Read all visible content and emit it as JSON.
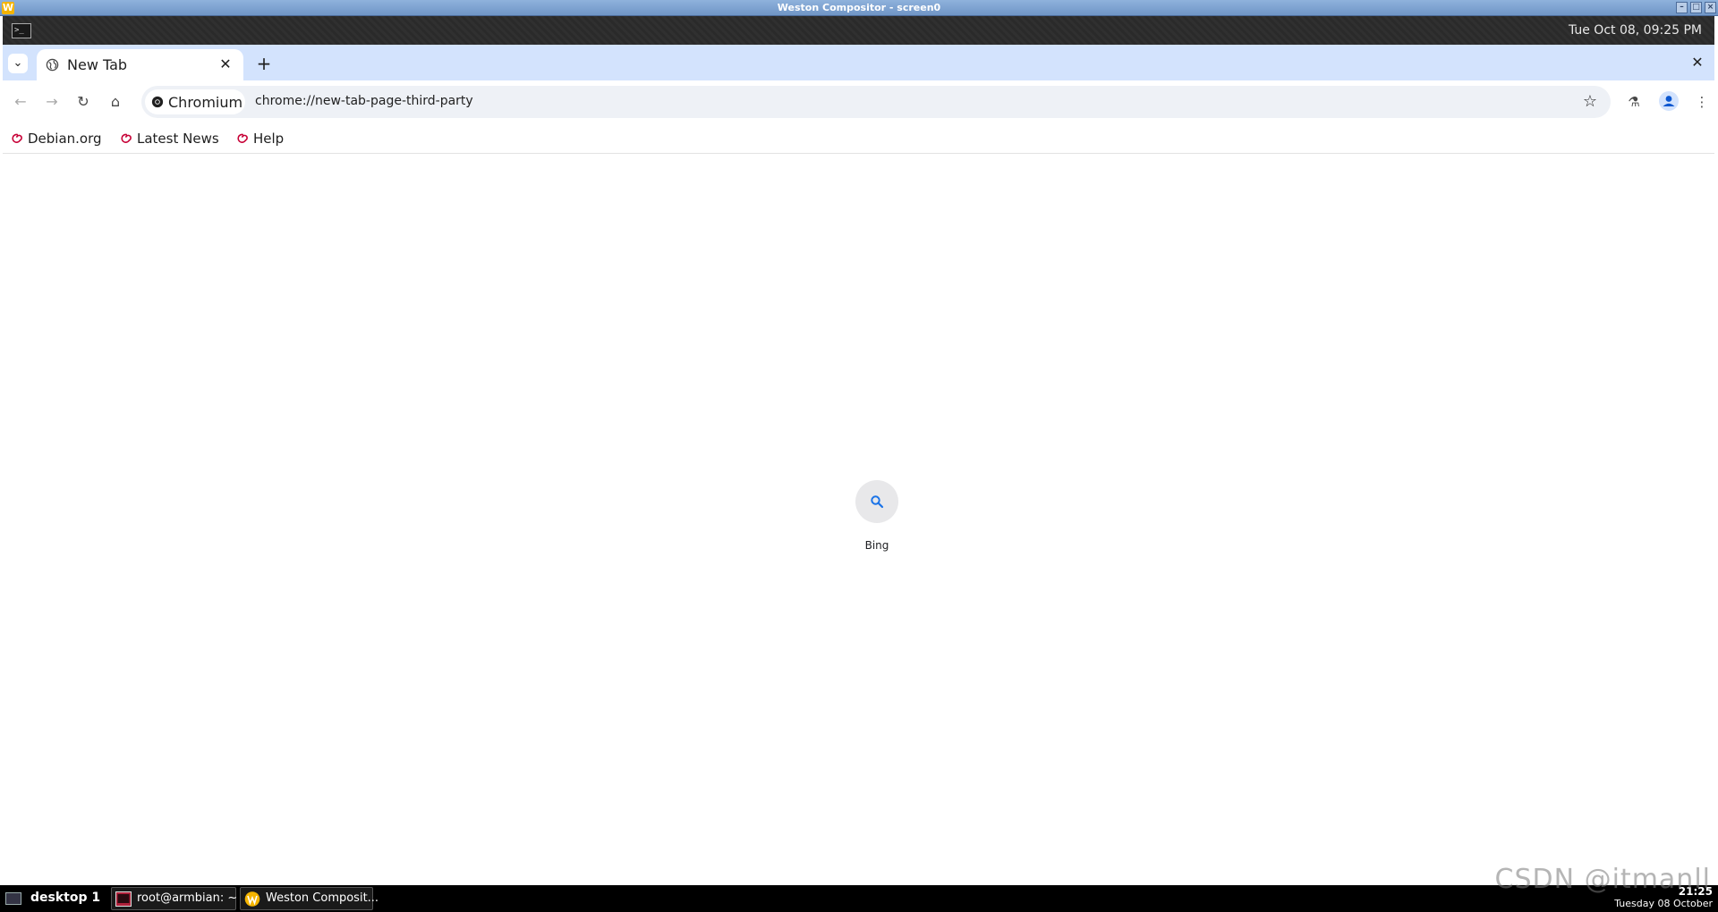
{
  "weston": {
    "window_title": "Weston Compositor - screen0",
    "panel_clock": "Tue Oct 08, 09:25 PM"
  },
  "browser": {
    "tab": {
      "title": "New Tab"
    },
    "omnibox": {
      "chip_label": "Chromium",
      "url": "chrome://new-tab-page-third-party"
    },
    "bookmarks": [
      {
        "label": "Debian.org"
      },
      {
        "label": "Latest News"
      },
      {
        "label": "Help"
      }
    ],
    "shortcut": {
      "label": "Bing"
    }
  },
  "taskbar": {
    "desktop_label": "desktop 1",
    "tasks": [
      {
        "label": "root@armbian: ~"
      },
      {
        "label": "Weston Composit..."
      }
    ],
    "clock_time": "21:25",
    "clock_date": "Tuesday 08 October"
  },
  "watermark": "CSDN @itmanll",
  "colors": {
    "accent_blue": "#0b57d0",
    "tabstrip_bg": "#d3e3fd",
    "debian_red": "#c70036"
  }
}
